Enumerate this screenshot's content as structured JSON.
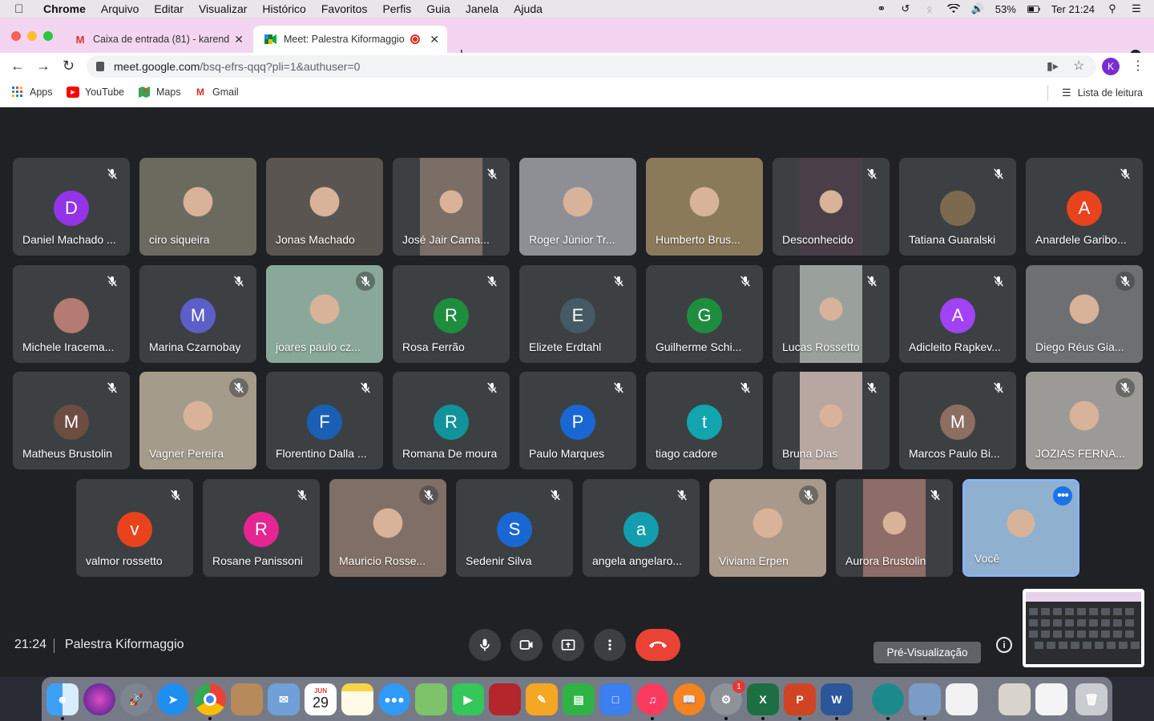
{
  "menubar": {
    "app": "Chrome",
    "items": [
      "Arquivo",
      "Editar",
      "Visualizar",
      "Histórico",
      "Favoritos",
      "Perfis",
      "Guia",
      "Janela",
      "Ajuda"
    ],
    "battery": "53%",
    "clock": "Ter 21:24"
  },
  "tabs": [
    {
      "title": "Caixa de entrada (81) - karend",
      "icon": "gmail-icon"
    },
    {
      "title": "Meet: Palestra Kiformaggio",
      "icon": "meet-icon"
    }
  ],
  "toolbar": {
    "url_host": "meet.google.com",
    "url_path": "/bsq-efrs-qqq?pli=1&authuser=0",
    "profile_initial": "K"
  },
  "bookmarks": [
    {
      "label": "Apps",
      "icon": "apps-grid-icon"
    },
    {
      "label": "YouTube",
      "icon": "youtube-icon"
    },
    {
      "label": "Maps",
      "icon": "maps-icon"
    },
    {
      "label": "Gmail",
      "icon": "gmail-icon"
    }
  ],
  "reading_list": "Lista de leitura",
  "participants": [
    {
      "name": "Daniel Machado ...",
      "initial": "D",
      "color": "#9334e6",
      "video": false,
      "muted": true
    },
    {
      "name": "ciro siqueira",
      "video": true,
      "vcolor": "#6b6a5f",
      "muted": false
    },
    {
      "name": "Jonas Machado",
      "video": true,
      "vcolor": "#5a5550",
      "muted": false
    },
    {
      "name": "José Jair Cama...",
      "video": true,
      "vcolor": "#7a6e66",
      "muted": true
    },
    {
      "name": "Roger Júnior Tr...",
      "video": true,
      "vcolor": "#8d8f94",
      "muted": false
    },
    {
      "name": "Humberto Brus...",
      "video": true,
      "vcolor": "#8a7a5a",
      "muted": false
    },
    {
      "name": "Desconhecido",
      "video": true,
      "vcolor": "#4a3f48",
      "muted": true
    },
    {
      "name": "Tatiana Guaralski",
      "initial": "",
      "color": "#7d6a4e",
      "video": false,
      "photo": true,
      "muted": true
    },
    {
      "name": "Anardele Garibo...",
      "initial": "A",
      "color": "#e8431d",
      "video": false,
      "muted": true
    },
    {
      "name": "Michele Iracema...",
      "initial": "",
      "color": "#b57a72",
      "video": false,
      "photo": true,
      "muted": true
    },
    {
      "name": "Marina Czarnobay",
      "initial": "M",
      "color": "#5b5fc7",
      "video": false,
      "muted": true
    },
    {
      "name": "joares paulo cz...",
      "video": true,
      "vcolor": "#8aa89a",
      "muted": true
    },
    {
      "name": "Rosa Ferrão",
      "initial": "R",
      "color": "#1e8e3e",
      "video": false,
      "muted": true
    },
    {
      "name": "Elizete Erdtahl",
      "initial": "E",
      "color": "#455a64",
      "video": false,
      "muted": true
    },
    {
      "name": "Guilherme Schi...",
      "initial": "G",
      "color": "#1e8e3e",
      "video": false,
      "muted": true
    },
    {
      "name": "Lucas Rossetto",
      "video": true,
      "vcolor": "#9aa19c",
      "muted": true
    },
    {
      "name": "Adicleito Rapkev...",
      "initial": "A",
      "color": "#a142f4",
      "video": false,
      "muted": true
    },
    {
      "name": "Diego Réus Gia...",
      "video": true,
      "vcolor": "#6d6f72",
      "muted": true
    },
    {
      "name": "Matheus Brustolin",
      "initial": "M",
      "color": "#6d4c41",
      "video": false,
      "muted": true
    },
    {
      "name": "Vagner Pereira",
      "video": true,
      "vcolor": "#a49b8a",
      "muted": true
    },
    {
      "name": "Florentino Dalla ...",
      "initial": "F",
      "color": "#1a5fb4",
      "video": false,
      "muted": true
    },
    {
      "name": "Romana De moura",
      "initial": "R",
      "color": "#12939a",
      "video": false,
      "muted": true
    },
    {
      "name": "Paulo Marques",
      "initial": "P",
      "color": "#1967d2",
      "video": false,
      "muted": true
    },
    {
      "name": "tiago cadore",
      "initial": "t",
      "color": "#12a4af",
      "video": false,
      "muted": true
    },
    {
      "name": "Bruna Dias",
      "video": true,
      "vcolor": "#b8a6a0",
      "muted": true
    },
    {
      "name": "Marcos Paulo Bi...",
      "initial": "M",
      "color": "#8d6e63",
      "video": false,
      "muted": true
    },
    {
      "name": "JOZIAS FERNA...",
      "video": true,
      "vcolor": "#9c9a96",
      "muted": true
    },
    {
      "name": "valmor rossetto",
      "initial": "v",
      "color": "#e8431d",
      "video": false,
      "muted": true
    },
    {
      "name": "Rosane Panissoni",
      "initial": "R",
      "color": "#e52592",
      "video": false,
      "muted": true
    },
    {
      "name": "Mauricio Rosse...",
      "video": true,
      "vcolor": "#7f6f66",
      "muted": true
    },
    {
      "name": "Sedenir Silva",
      "initial": "S",
      "color": "#1967d2",
      "video": false,
      "muted": true
    },
    {
      "name": "angela angelaro...",
      "initial": "a",
      "color": "#129eaf",
      "video": false,
      "muted": true
    },
    {
      "name": "Viviana Erpen",
      "video": true,
      "vcolor": "#a8998a",
      "muted": true
    },
    {
      "name": "Aurora Brustolin",
      "video": true,
      "vcolor": "#8e6c67",
      "muted": true
    },
    {
      "name": "Você",
      "video": true,
      "vcolor": "#8fb0cf",
      "muted": false,
      "self": true
    }
  ],
  "meeting": {
    "time": "21:24",
    "name": "Palestra Kiformaggio",
    "tooltip": "Pré-Visualização"
  },
  "dock": {
    "calendar_month": "JUN",
    "calendar_day": "29",
    "settings_badge": "1"
  }
}
